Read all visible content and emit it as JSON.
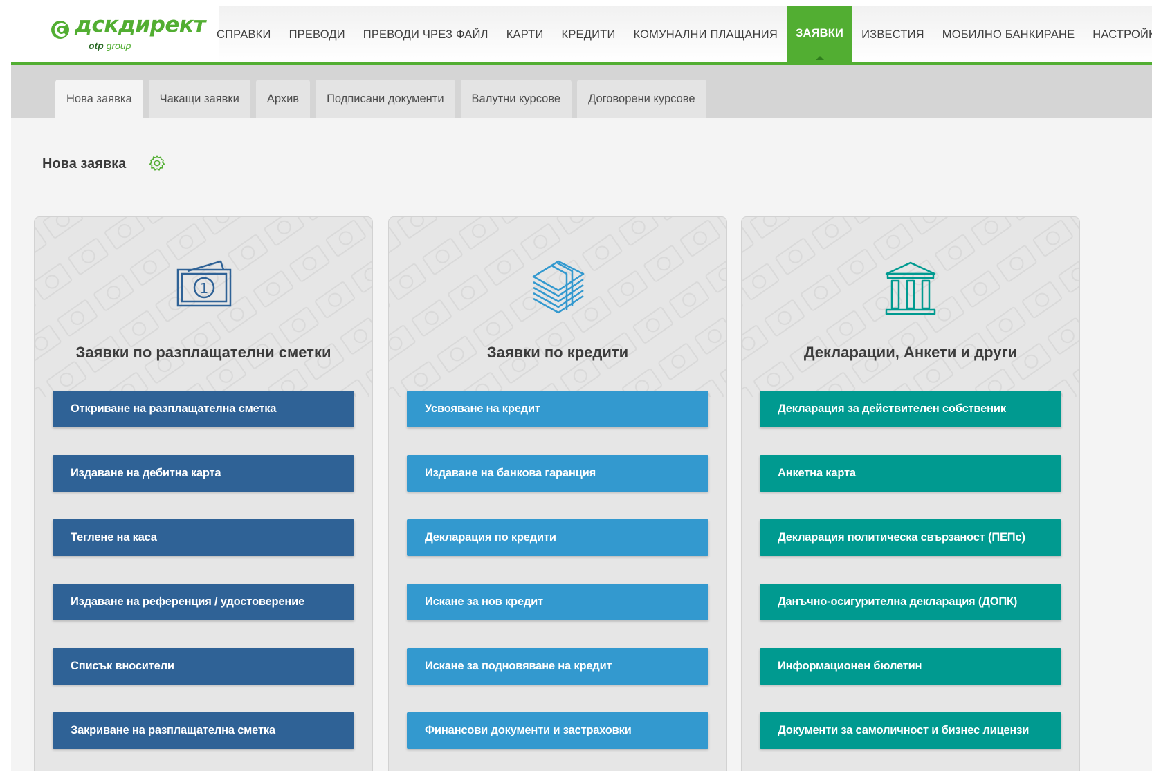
{
  "colors": {
    "brand_green": "#52ae32",
    "dark_blue": "#2f6296",
    "light_blue": "#3399cf",
    "teal": "#009a90"
  },
  "logo": {
    "name": "дскдирект",
    "sub_bold": "otp",
    "sub": "group"
  },
  "nav": {
    "items": [
      {
        "label": "СПРАВКИ"
      },
      {
        "label": "ПРЕВОДИ"
      },
      {
        "label": "ПРЕВОДИ ЧРЕЗ ФАЙЛ"
      },
      {
        "label": "КАРТИ"
      },
      {
        "label": "КРЕДИТИ"
      },
      {
        "label": "КОМУНАЛНИ ПЛАЩАНИЯ"
      },
      {
        "label": "ЗАЯВКИ"
      },
      {
        "label": "ИЗВЕСТИЯ"
      },
      {
        "label": "МОБИЛНО БАНКИРАНЕ"
      },
      {
        "label": "НАСТРОЙКИ"
      }
    ],
    "active": "ЗАЯВКИ"
  },
  "subtabs": {
    "items": [
      {
        "label": "Нова заявка"
      },
      {
        "label": "Чакащи заявки"
      },
      {
        "label": "Архив"
      },
      {
        "label": "Подписани документи"
      },
      {
        "label": "Валутни курсове"
      },
      {
        "label": "Договорени курсове"
      }
    ],
    "active": "Нова заявка"
  },
  "page": {
    "title": "Нова заявка",
    "settings_icon": "gear-icon"
  },
  "cards": [
    {
      "icon": "banknote-icon",
      "title": "Заявки по разплащателни сметки",
      "buttons": [
        {
          "label": "Откриване на разплащателна сметка"
        },
        {
          "label": "Издаване на дебитна карта"
        },
        {
          "label": "Теглене на каса"
        },
        {
          "label": "Издаване на референция / удостоверение"
        },
        {
          "label": "Списък вносители"
        },
        {
          "label": "Закриване на разплащателна сметка"
        }
      ]
    },
    {
      "icon": "money-stack-icon",
      "title": "Заявки по кредити",
      "buttons": [
        {
          "label": "Усвояване на кредит"
        },
        {
          "label": "Издаване на банкова гаранция"
        },
        {
          "label": "Декларация по кредити"
        },
        {
          "label": "Искане за нов кредит"
        },
        {
          "label": "Искане за подновяване на кредит"
        },
        {
          "label": "Финансови документи и застраховки"
        }
      ]
    },
    {
      "icon": "bank-building-icon",
      "title": "Декларации, Анкети и други",
      "buttons": [
        {
          "label": "Декларация за действителен собственик"
        },
        {
          "label": "Анкетна карта"
        },
        {
          "label": "Декларация политическа свързаност (ПЕПс)"
        },
        {
          "label": "Данъчно-осигурителна декларация (ДОПК)"
        },
        {
          "label": "Информационен бюлетин"
        },
        {
          "label": "Документи за самоличност и бизнес лицензи"
        }
      ]
    }
  ]
}
